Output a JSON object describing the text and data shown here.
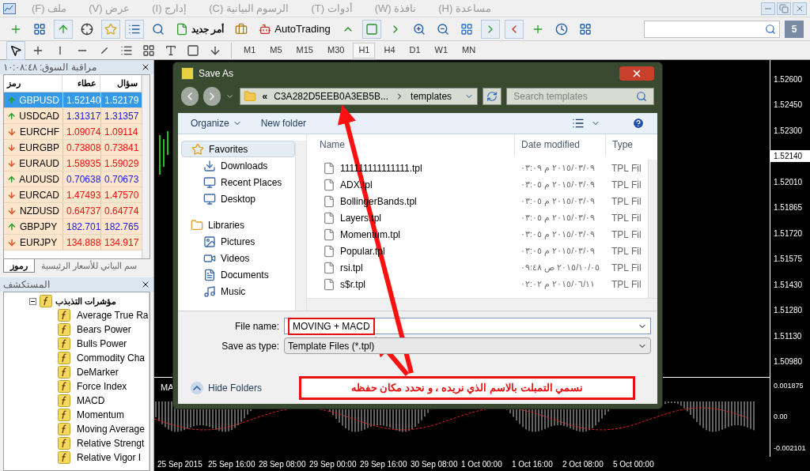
{
  "menu": [
    "مساعدة (H)",
    "نافذة (W)",
    "أدوات (T)",
    "الرسوم البيانية (C)",
    "إدارج (I)",
    "عرض (V)",
    "ملف (F)"
  ],
  "toolbar": {
    "new_order": "أمر جديد",
    "autotrading": "AutoTrading",
    "notifications": "5"
  },
  "timeframes": [
    {
      "label": "M1",
      "selected": false
    },
    {
      "label": "M5",
      "selected": false
    },
    {
      "label": "M15",
      "selected": false
    },
    {
      "label": "M30",
      "selected": false
    },
    {
      "label": "H1",
      "selected": true
    },
    {
      "label": "H4",
      "selected": false
    },
    {
      "label": "D1",
      "selected": false
    },
    {
      "label": "W1",
      "selected": false
    },
    {
      "label": "MN",
      "selected": false
    }
  ],
  "market_watch": {
    "title": "مراقبة السوق: ١٠:٠٨:٤٨",
    "columns": [
      "سؤال",
      "عطاء",
      "رمز"
    ],
    "rows": [
      {
        "symbol": "GBPUSD",
        "bid": "1.52140",
        "ask": "1.52179",
        "rising": true,
        "selected": true
      },
      {
        "symbol": "USDCAD",
        "bid": "1.31317",
        "ask": "1.31357",
        "rising": true,
        "selected": false
      },
      {
        "symbol": "EURCHF",
        "bid": "1.09074",
        "ask": "1.09114",
        "rising": false,
        "selected": false
      },
      {
        "symbol": "EURGBP",
        "bid": "0.73808",
        "ask": "0.73841",
        "rising": false,
        "selected": false
      },
      {
        "symbol": "EURAUD",
        "bid": "1.58935",
        "ask": "1.59029",
        "rising": false,
        "selected": false
      },
      {
        "symbol": "AUDUSD",
        "bid": "0.70638",
        "ask": "0.70673",
        "rising": true,
        "selected": false
      },
      {
        "symbol": "EURCAD",
        "bid": "1.47493",
        "ask": "1.47570",
        "rising": false,
        "selected": false
      },
      {
        "symbol": "NZDUSD",
        "bid": "0.64737",
        "ask": "0.64774",
        "rising": false,
        "selected": false
      },
      {
        "symbol": "GBPJPY",
        "bid": "182.701",
        "ask": "182.765",
        "rising": true,
        "selected": false
      },
      {
        "symbol": "EURJPY",
        "bid": "134.888",
        "ask": "134.917",
        "rising": false,
        "selected": false
      }
    ],
    "tabs": [
      {
        "label": "سم البياني للأسعار الرئيسية",
        "selected": false
      },
      {
        "label": "رموز",
        "selected": true
      }
    ]
  },
  "navigator": {
    "title": "المستكشف",
    "tree": [
      {
        "label": "مؤشرات التذبذب",
        "expanded": true,
        "children": [
          {
            "label": "Average True Ra"
          },
          {
            "label": "Bears Power"
          },
          {
            "label": "Bulls Power"
          },
          {
            "label": "Commodity Cha"
          },
          {
            "label": "DeMarker"
          },
          {
            "label": "Force Index"
          },
          {
            "label": "MACD"
          },
          {
            "label": "Momentum"
          },
          {
            "label": "Moving Average"
          },
          {
            "label": "Relative Strengt"
          },
          {
            "label": "Relative Vigor I"
          }
        ]
      }
    ]
  },
  "chart": {
    "price_labels": [
      {
        "label": "1.52600",
        "current": false
      },
      {
        "label": "1.52450",
        "current": false
      },
      {
        "label": "1.52300",
        "current": false
      },
      {
        "label": "1.52140",
        "current": true
      },
      {
        "label": "1.52010",
        "current": false
      },
      {
        "label": "1.51865",
        "current": false
      },
      {
        "label": "1.51720",
        "current": false
      },
      {
        "label": "1.51575",
        "current": false
      },
      {
        "label": "1.51430",
        "current": false
      },
      {
        "label": "1.51280",
        "current": false
      },
      {
        "label": "1.51130",
        "current": false
      },
      {
        "label": "1.50980",
        "current": false
      }
    ],
    "indicator_label": "MA",
    "indicator_levels": [
      "0.001875",
      "0.00",
      "-0.002101"
    ],
    "time_labels": [
      "25 Sep 2015",
      "25 Sep 16:00",
      "28 Sep 08:00",
      "29 Sep 00:00",
      "29 Sep 16:00",
      "30 Sep 08:00",
      "1 Oct 00:00",
      "1 Oct 16:00",
      "2 Oct 08:00",
      "5 Oct 00:00"
    ]
  },
  "dialog": {
    "title": "Save As",
    "path": [
      "«",
      "C3A282D5EEB0A3EB5B...",
      "templates"
    ],
    "search_placeholder": "Search templates",
    "commands": [
      "Organize",
      "New folder"
    ],
    "nav": [
      {
        "label": "Favorites",
        "kind": "group",
        "selected": true
      },
      {
        "label": "Downloads",
        "kind": "item",
        "selected": false
      },
      {
        "label": "Recent Places",
        "kind": "item",
        "selected": false
      },
      {
        "label": "Desktop",
        "kind": "item",
        "selected": false
      },
      {
        "label": "Libraries",
        "kind": "group",
        "selected": false
      },
      {
        "label": "Pictures",
        "kind": "item",
        "selected": false
      },
      {
        "label": "Videos",
        "kind": "item",
        "selected": false
      },
      {
        "label": "Documents",
        "kind": "item",
        "selected": false
      },
      {
        "label": "Music",
        "kind": "item",
        "selected": false
      }
    ],
    "columns": [
      "Name",
      "Date modified",
      "Type"
    ],
    "files": [
      {
        "name": "111111111111111.tpl",
        "date": "٢٠١٥/٠٣/٠٩ م ٠٣:٠٩",
        "type": "TPL Fil"
      },
      {
        "name": "ADX.tpl",
        "date": "٢٠١٥/٠٣/٠٩ م ٠٣:٠٥",
        "type": "TPL Fil"
      },
      {
        "name": "BollingerBands.tpl",
        "date": "٢٠١٥/٠٣/٠٩ م ٠٣:٠٥",
        "type": "TPL Fil"
      },
      {
        "name": "Layers.tpl",
        "date": "٢٠١٥/٠٣/٠٩ م ٠٣:٠٥",
        "type": "TPL Fil"
      },
      {
        "name": "Momentum.tpl",
        "date": "٢٠١٥/٠٣/٠٩ م ٠٣:٠٥",
        "type": "TPL Fil"
      },
      {
        "name": "Popular.tpl",
        "date": "٢٠١٥/٠٣/٠٩ م ٠٣:٠٥",
        "type": "TPL Fil"
      },
      {
        "name": "rsi.tpl",
        "date": "٢٠١٥/١٠/٠٥ ص ٠٩:٤٨",
        "type": "TPL Fil"
      },
      {
        "name": "s$r.tpl",
        "date": "٢٠١٥/٠٦/١١ م ٠٢:٠٢",
        "type": "TPL Fil"
      }
    ],
    "file_name_label": "File name:",
    "file_name": "MOVING + MACD",
    "type_label": "Save as type:",
    "type_value": "Template Files (*.tpl)",
    "hide_folders": "Hide Folders"
  },
  "annotation": "نسمي التمبلت بالاسم الذي نريده ، و نحدد مكان حفظه"
}
